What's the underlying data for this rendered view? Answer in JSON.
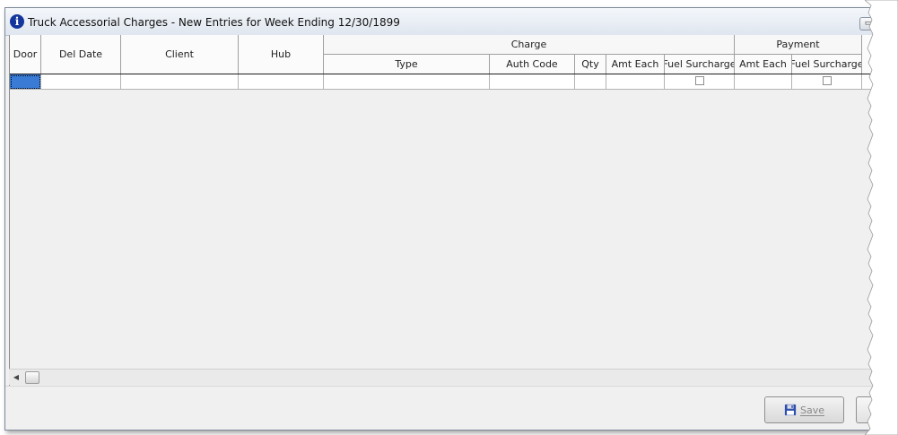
{
  "window": {
    "title": "Truck Accessorial Charges - New Entries for Week Ending 12/30/1899"
  },
  "grid": {
    "columns": {
      "door": "Door",
      "del_date": "Del Date",
      "client": "Client",
      "hub": "Hub"
    },
    "charge_group": {
      "label": "Charge",
      "type": "Type",
      "auth_code": "Auth Code",
      "qty": "Qty",
      "amt_each": "Amt Each",
      "fuel_surcharge": "Fuel Surcharge"
    },
    "payment_group": {
      "label": "Payment",
      "amt_each": "Amt Each",
      "fuel_surcharge": "Fuel Surcharge"
    },
    "rows": [
      {
        "door": "",
        "del_date": "",
        "client": "",
        "hub": "",
        "type": "",
        "auth_code": "",
        "qty": "",
        "amt_each": "",
        "fuel_surcharge_checked": false,
        "payment_amt_each": "",
        "payment_fuel_surcharge_checked": false
      }
    ]
  },
  "footer": {
    "save_label": "Save",
    "save_enabled": false
  },
  "colors": {
    "selection": "#3a7bd5",
    "info_icon": "#14369c",
    "title_bar": "#dfe6ef"
  },
  "icons": {
    "title": "info-icon",
    "save": "floppy-disk-icon",
    "scroll_left": "arrow-left-icon"
  }
}
